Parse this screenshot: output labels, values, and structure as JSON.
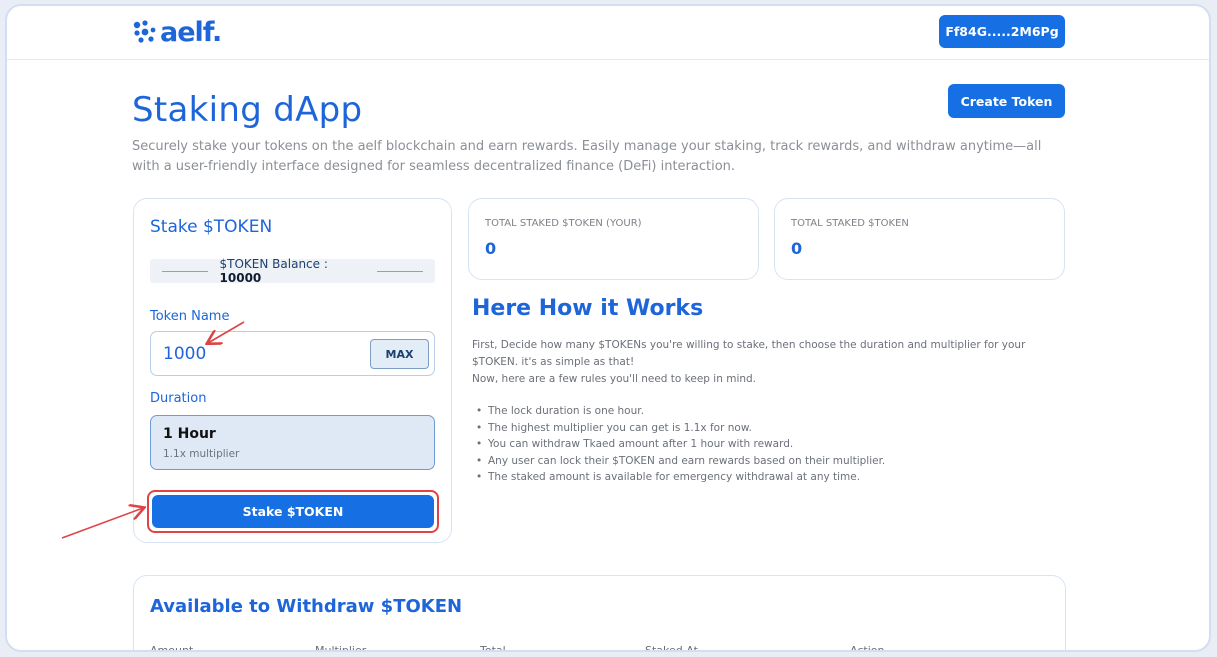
{
  "header": {
    "logo_text": "aelf.",
    "wallet_label": "Ff84G.....2M6Pg"
  },
  "hero": {
    "title": "Staking dApp",
    "create_token_label": "Create Token",
    "description": "Securely stake your tokens on the aelf blockchain and earn rewards. Easily manage your staking, track rewards, and withdraw anytime—all with a user-friendly interface designed for seamless decentralized finance (DeFi) interaction."
  },
  "stake": {
    "title": "Stake $TOKEN",
    "balance_label": "$TOKEN Balance : ",
    "balance_value": "10000",
    "token_name_label": "Token Name",
    "token_input_value": "1000",
    "max_label": "MAX",
    "duration_label": "Duration",
    "duration_option": {
      "name": "1 Hour",
      "multiplier": "1.1x multiplier"
    },
    "submit_label": "Stake $TOKEN"
  },
  "stats": [
    {
      "label": "TOTAL STAKED $TOKEN (YOUR)",
      "value": "0"
    },
    {
      "label": "TOTAL STAKED $TOKEN",
      "value": "0"
    }
  ],
  "how": {
    "title": "Here How it Works",
    "intro_line_1": "First, Decide how many $TOKENs you're willing to stake, then choose the duration and multiplier for your $TOKEN. it's as simple as that!",
    "intro_line_2": "Now, here are a few rules you'll need to keep in mind.",
    "rules": [
      "The lock duration is one hour.",
      "The highest multiplier you can get is 1.1x for now.",
      "You can withdraw Tkaed amount after 1 hour with reward.",
      "Any user can lock their $TOKEN and earn rewards based on their multiplier.",
      "The staked amount is available for emergency withdrawal at any time."
    ]
  },
  "withdraw": {
    "title": "Available to Withdraw $TOKEN",
    "columns": [
      "Amount",
      "Multiplier",
      "Total",
      "Staked At",
      "Action"
    ]
  },
  "colors": {
    "brand_blue": "#1670e4",
    "heading_blue": "#1d65d8",
    "annotation_red": "#e04343"
  }
}
